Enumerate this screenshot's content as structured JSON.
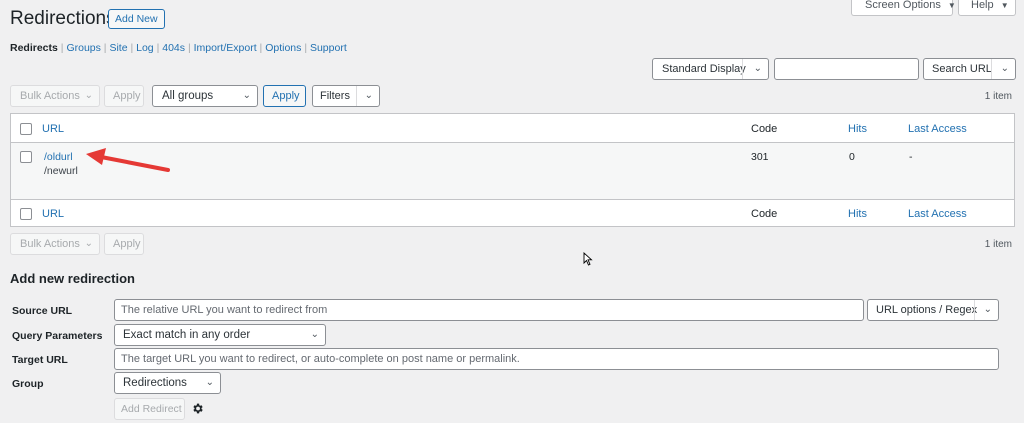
{
  "header": {
    "title": "Redirections",
    "add_new": "Add New",
    "screen_options": "Screen Options",
    "help": "Help"
  },
  "subnav": {
    "items": [
      "Redirects",
      "Groups",
      "Site",
      "Log",
      "404s",
      "Import/Export",
      "Options",
      "Support"
    ],
    "separator": "|"
  },
  "display": {
    "mode": "Standard Display",
    "search_value": "",
    "search_button": "Search URL"
  },
  "top_actions": {
    "bulk_actions": "Bulk Actions",
    "apply": "Apply",
    "group_filter": "All groups",
    "apply_filter": "Apply",
    "filters": "Filters",
    "count": "1 item"
  },
  "table": {
    "columns": {
      "url": "URL",
      "code": "Code",
      "hits": "Hits",
      "last_access": "Last Access"
    },
    "rows": [
      {
        "source": "/oldurl",
        "target": "/newurl",
        "code": "301",
        "hits": "0",
        "last_access": "-"
      }
    ]
  },
  "bottom_actions": {
    "bulk_actions": "Bulk Actions",
    "apply": "Apply",
    "count": "1 item"
  },
  "form": {
    "heading": "Add new redirection",
    "source_label": "Source URL",
    "source_placeholder": "The relative URL you want to redirect from",
    "url_options": "URL options / Regex",
    "query_label": "Query Parameters",
    "query_value": "Exact match in any order",
    "target_label": "Target URL",
    "target_placeholder": "The target URL you want to redirect, or auto-complete on post name or permalink.",
    "group_label": "Group",
    "group_value": "Redirections",
    "submit": "Add Redirect"
  },
  "colors": {
    "link": "#2271b1",
    "annotation_arrow": "#e53935",
    "background": "#f0f0f1"
  }
}
